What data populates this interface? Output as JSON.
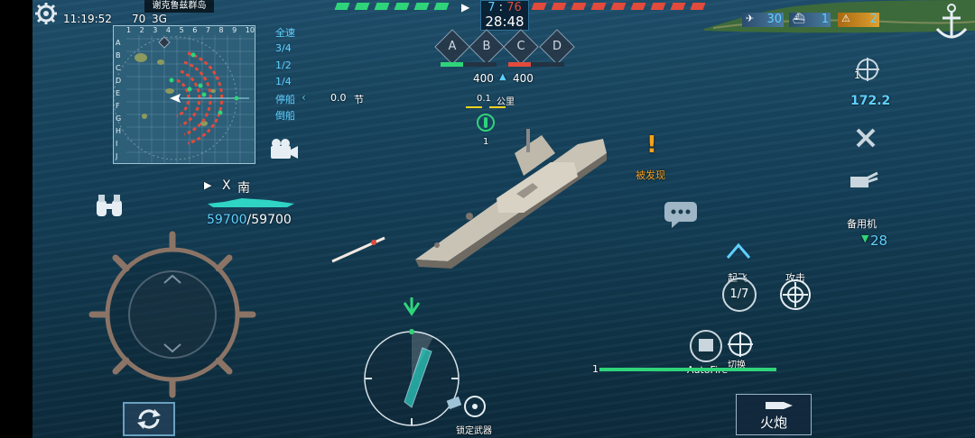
{
  "system": {
    "time": "11:19:52",
    "ping": "70",
    "network": "3G"
  },
  "minimap": {
    "region_name": "谢克鲁兹群岛",
    "col_labels": [
      "1",
      "2",
      "3",
      "4",
      "5",
      "6",
      "7",
      "8",
      "9",
      "10"
    ],
    "row_labels": [
      "A",
      "B",
      "C",
      "D",
      "E",
      "F",
      "G",
      "H",
      "I",
      "J"
    ]
  },
  "speed_menu": {
    "items": [
      "全速",
      "3/4",
      "1/2",
      "1/4",
      "停船",
      "倒船"
    ],
    "current_speed": "0.0",
    "unit": "节"
  },
  "score": {
    "team_a": "7",
    "separator": ":",
    "team_b": "76",
    "timer": "28:48"
  },
  "capture_points": [
    "A",
    "B",
    "C",
    "D"
  ],
  "capture_bars": {
    "left": "400",
    "right": "400"
  },
  "target": {
    "distance": "0.1",
    "unit": "公里",
    "count": "1"
  },
  "detected_label": "被发现",
  "player": {
    "direction_marker": "X",
    "heading": "南",
    "hp_current": "59700",
    "hp_max": "59700"
  },
  "resources": {
    "aircraft": "30",
    "ships": "1",
    "items": "2"
  },
  "right_panel": {
    "gun_count": "1",
    "radar_value": "172.2",
    "reserve_label": "备用机",
    "reserve_count": "28"
  },
  "actions": {
    "takeoff_label": "起飞",
    "takeoff_count": "1/7",
    "attack_label": "攻击",
    "switch_label": "切换",
    "autofire_label": "AutoFire",
    "weapon_slot": "1",
    "lock_weapon_label": "锁定武器",
    "fire_label": "火炮"
  },
  "colors": {
    "friendly": "#2fd47a",
    "enemy": "#e24a3b",
    "ui_cyan": "#5fd0ff",
    "accent_orange": "#f5a11c",
    "hp": "#5fd0ff"
  }
}
